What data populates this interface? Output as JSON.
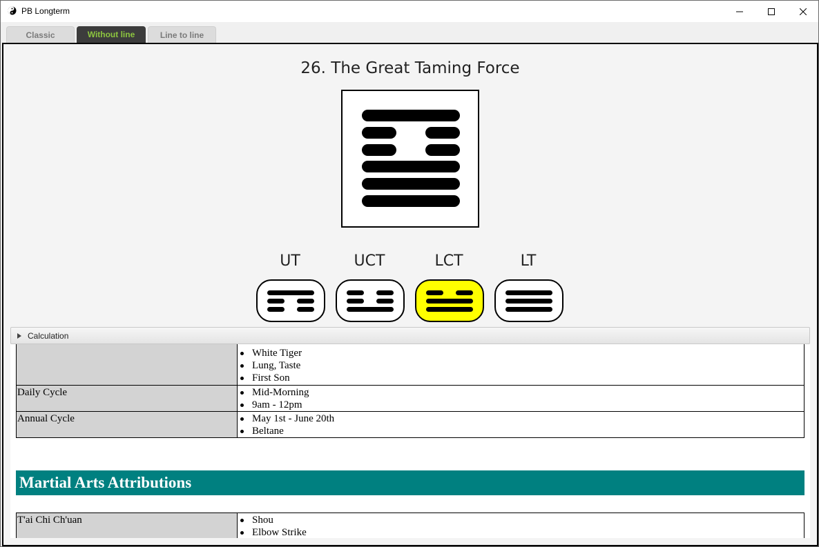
{
  "window": {
    "title": "PB Longterm",
    "icon": "yin-yang-icon"
  },
  "tabs": [
    {
      "label": "Classic",
      "active": false
    },
    {
      "label": "Without line",
      "active": true
    },
    {
      "label": "Line to line",
      "active": false
    }
  ],
  "hexagram": {
    "title": "26. The Great Taming Force",
    "lines_top_to_bottom": [
      "solid",
      "broken",
      "broken",
      "solid",
      "solid",
      "solid"
    ]
  },
  "trigrams": [
    {
      "label": "UT",
      "lines_top_to_bottom": [
        "solid",
        "broken",
        "broken"
      ],
      "selected": false
    },
    {
      "label": "UCT",
      "lines_top_to_bottom": [
        "broken",
        "broken",
        "solid"
      ],
      "selected": false
    },
    {
      "label": "LCT",
      "lines_top_to_bottom": [
        "broken",
        "solid",
        "solid"
      ],
      "selected": true
    },
    {
      "label": "LT",
      "lines_top_to_bottom": [
        "solid",
        "solid",
        "solid"
      ],
      "selected": false
    }
  ],
  "calculation": {
    "label": "Calculation",
    "expanded": false
  },
  "attributions": {
    "rows": [
      {
        "label": "",
        "items": [
          "White Tiger",
          "Lung, Taste",
          "First Son"
        ]
      },
      {
        "label": "Daily Cycle",
        "items": [
          "Mid-Morning",
          "9am - 12pm"
        ]
      },
      {
        "label": "Annual Cycle",
        "items": [
          "May 1st - June 20th",
          "Beltane"
        ]
      }
    ]
  },
  "martial": {
    "heading": "Martial Arts Attributions",
    "rows": [
      {
        "label": "T'ai Chi Ch'uan",
        "items": [
          "Shou",
          "Elbow Strike"
        ]
      }
    ]
  },
  "colors": {
    "accent_tab_text": "#8dc63f",
    "section_header": "#008080",
    "selected_trigram": "#ffff00"
  }
}
